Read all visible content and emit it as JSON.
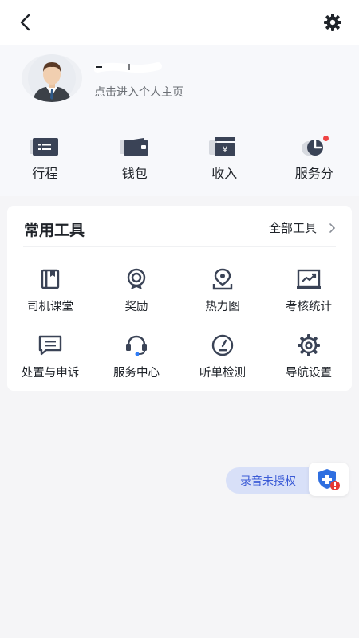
{
  "topbar": {
    "back_icon": "chevron-left-icon",
    "settings_icon": "gear-icon"
  },
  "profile": {
    "link_text": "点击进入个人主页"
  },
  "quick_actions": [
    {
      "label": "行程",
      "icon": "trip-list-icon"
    },
    {
      "label": "钱包",
      "icon": "wallet-icon"
    },
    {
      "label": "收入",
      "icon": "income-icon"
    },
    {
      "label": "服务分",
      "icon": "service-score-icon",
      "badge_color": "#ef4444"
    }
  ],
  "tools": {
    "title": "常用工具",
    "all_label": "全部工具",
    "items": [
      {
        "label": "司机课堂",
        "icon": "book-icon"
      },
      {
        "label": "奖励",
        "icon": "reward-icon"
      },
      {
        "label": "热力图",
        "icon": "map-pin-icon"
      },
      {
        "label": "考核统计",
        "icon": "chart-icon"
      },
      {
        "label": "处置与申诉",
        "icon": "message-icon"
      },
      {
        "label": "服务中心",
        "icon": "headset-icon"
      },
      {
        "label": "听单检测",
        "icon": "gauge-icon"
      },
      {
        "label": "导航设置",
        "icon": "gear-icon"
      }
    ]
  },
  "recording": {
    "label": "录音未授权",
    "icon": "shield-warning-icon"
  },
  "colors": {
    "icon_dark": "#3a4356",
    "accent_blue": "#3b5bd6",
    "warning_red": "#e53935"
  }
}
